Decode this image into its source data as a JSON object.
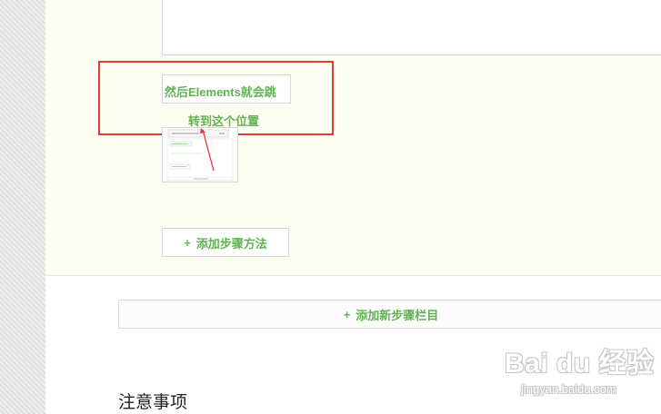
{
  "step": {
    "text_line1": "然后Elements就会跳",
    "text_line2": "转到这个位置",
    "add_method_label": "添加步骤方法"
  },
  "add_section_label": "添加新步骤栏目",
  "notes_heading": "注意事项",
  "watermark": {
    "logo": "Bai du 经验",
    "sub": "jingyan.baidu.com"
  },
  "colors": {
    "accent_green": "#62b255",
    "highlight_red": "#e53a3a",
    "step_bg": "#fefdf1"
  }
}
